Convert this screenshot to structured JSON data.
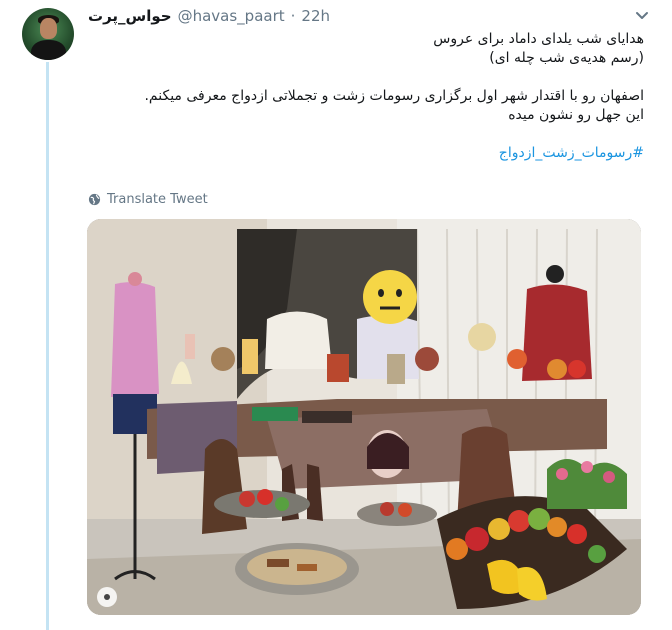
{
  "tweet": {
    "display_name": "حواس_پرت",
    "handle": "@havas_paart",
    "separator": "·",
    "time": "22h",
    "lines": [
      "هدایای شب یلدای داماد برای عروس",
      "(رسم هدیه‌ی شب چله ای)",
      "اصفهان رو با اقتدار شهر اول برگزاری رسومات زشت و تجملاتی ازدواج معرفی میکنم.",
      "این جهل رو نشون میده"
    ],
    "hashtag": "#رسومات_زشت_ازدواج",
    "translate_label": "Translate Tweet"
  },
  "icons": {
    "caret": "chevron-down-icon",
    "translate": "globe-icon",
    "media_control": "gif-indicator-icon"
  },
  "colors": {
    "accent": "#1b95e0",
    "thread_line": "#c4e3f3",
    "secondary_text": "#657786"
  }
}
